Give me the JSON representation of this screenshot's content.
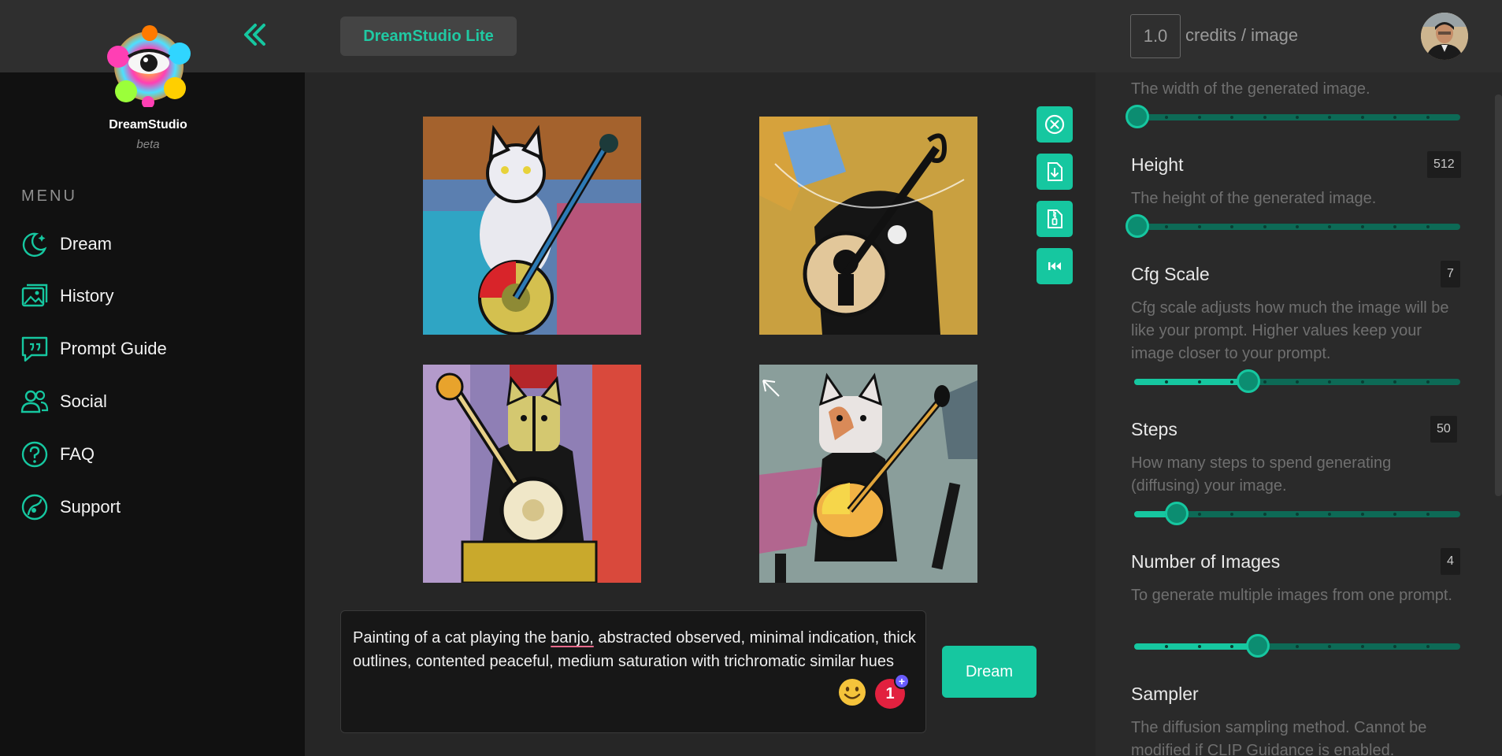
{
  "app": {
    "brand": "DreamStudio",
    "brand_sub": "beta",
    "chip_label": "DreamStudio Lite",
    "accent": "#16c7a0"
  },
  "header": {
    "credits_value": "1.0",
    "credits_label": "credits / image"
  },
  "sidebar": {
    "menu_label": "MENU",
    "items": [
      {
        "label": "Dream",
        "icon": "moon-stars-icon"
      },
      {
        "label": "History",
        "icon": "image-gallery-icon"
      },
      {
        "label": "Prompt Guide",
        "icon": "chat-quote-icon"
      },
      {
        "label": "Social",
        "icon": "users-icon"
      },
      {
        "label": "FAQ",
        "icon": "question-circle-icon"
      },
      {
        "label": "Support",
        "icon": "support-icon"
      }
    ]
  },
  "main": {
    "images": [
      {
        "alt": "cat-banjo-1"
      },
      {
        "alt": "cat-banjo-2"
      },
      {
        "alt": "cat-banjo-3"
      },
      {
        "alt": "cat-banjo-4"
      }
    ],
    "actions": [
      "close-circle-icon",
      "download-file-icon",
      "zip-file-icon",
      "skip-back-icon"
    ],
    "prompt": {
      "before": "Painting of a cat playing the ",
      "misspelled": "banjo,",
      "after": " abstracted observed, minimal indication, thick outlines, contented peaceful, medium saturation with trichromatic similar hues"
    },
    "notification_count": "1",
    "dream_button": "Dream"
  },
  "settings": {
    "width": {
      "desc": "The width of the generated image.",
      "level": 0.0
    },
    "height": {
      "title": "Height",
      "value": "512",
      "desc": "The height of the generated image.",
      "level": 0.0
    },
    "cfg": {
      "title": "Cfg Scale",
      "value": "7",
      "desc": "Cfg scale adjusts how much the image will be like your prompt. Higher values keep your image closer to your prompt.",
      "level": 0.35
    },
    "steps": {
      "title": "Steps",
      "value": "50",
      "desc": "How many steps to spend generating (diffusing) your image.",
      "level": 0.13
    },
    "num_images": {
      "title": "Number of Images",
      "value": "4",
      "desc": "To generate multiple images from one prompt.",
      "level": 0.38
    },
    "sampler": {
      "title": "Sampler",
      "desc": "The diffusion sampling method. Cannot be modified if CLIP Guidance is enabled."
    }
  }
}
